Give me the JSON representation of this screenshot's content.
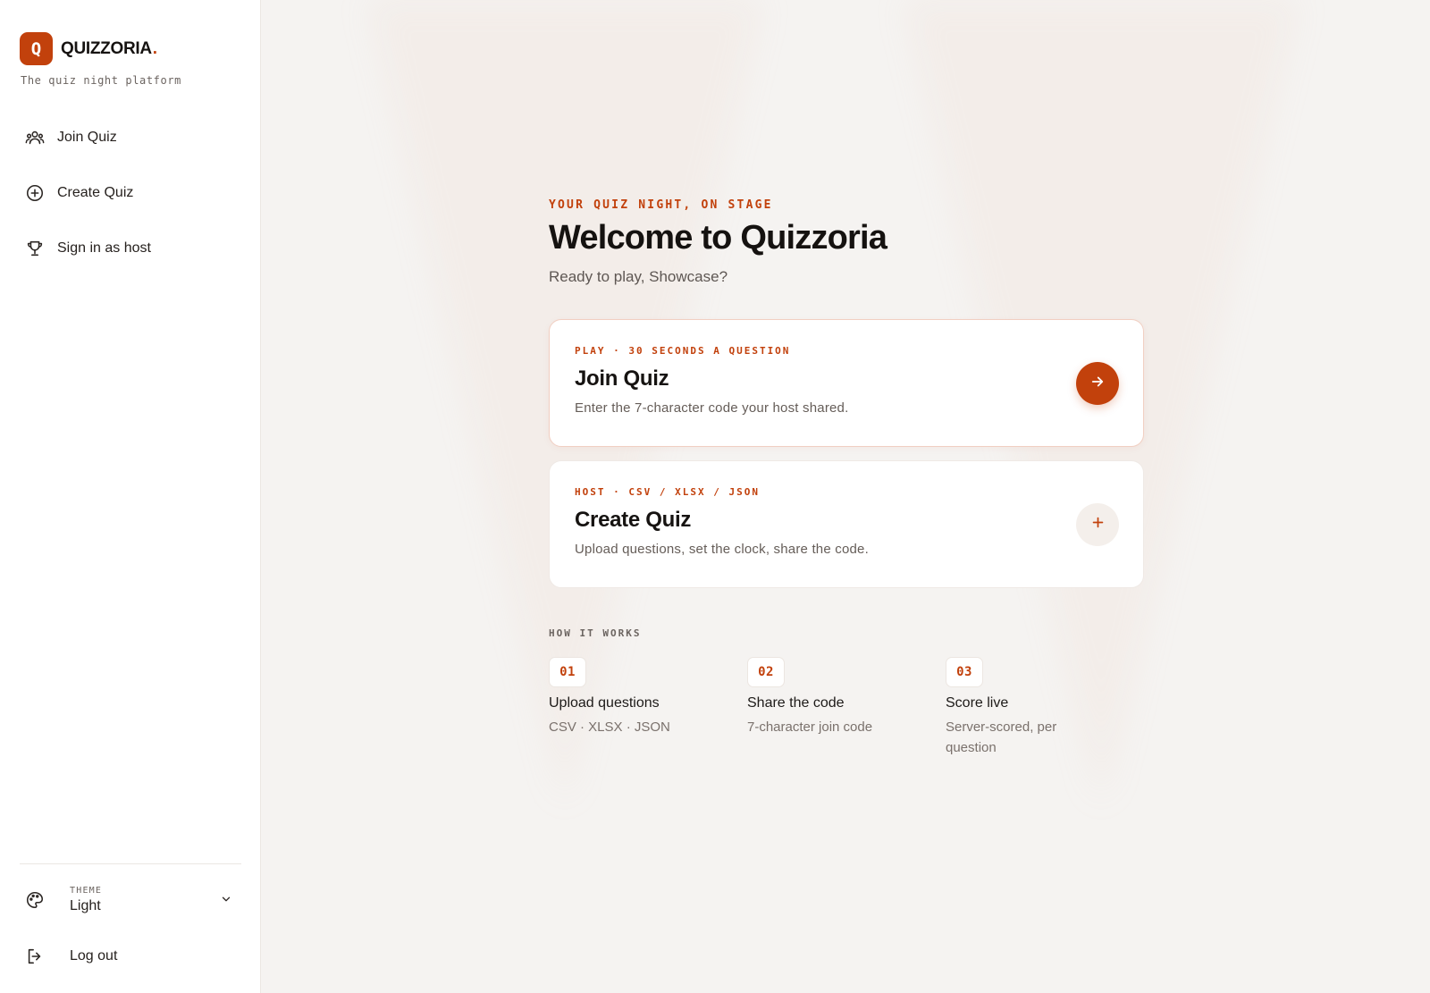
{
  "brand": {
    "logo_letter": "Q",
    "name": "QUIZZORIA",
    "dot": ".",
    "tagline": "The quiz night platform"
  },
  "sidebar": {
    "items": [
      {
        "label": "Join Quiz",
        "icon": "users-icon"
      },
      {
        "label": "Create Quiz",
        "icon": "plus-circle-icon"
      },
      {
        "label": "Sign in as host",
        "icon": "trophy-icon"
      }
    ],
    "theme": {
      "caption": "THEME",
      "value": "Light",
      "icon": "palette-icon"
    },
    "logout": {
      "label": "Log out",
      "icon": "logout-icon"
    }
  },
  "hero": {
    "eyebrow": "YOUR QUIZ NIGHT, ON STAGE",
    "title": "Welcome to Quizzoria",
    "subtitle": "Ready to play, Showcase?"
  },
  "cards": [
    {
      "kicker": "PLAY · 30 SECONDS A QUESTION",
      "title": "Join Quiz",
      "description": "Enter the 7-character code your host shared.",
      "action_icon": "arrow-right-icon"
    },
    {
      "kicker": "HOST · CSV / XLSX / JSON",
      "title": "Create Quiz",
      "description": "Upload questions, set the clock, share the code.",
      "action_icon": "plus-icon"
    }
  ],
  "how_it_works": {
    "title": "HOW IT WORKS",
    "steps": [
      {
        "number": "01",
        "title": "Upload questions",
        "description": "CSV · XLSX · JSON"
      },
      {
        "number": "02",
        "title": "Share the code",
        "description": "7-character join code"
      },
      {
        "number": "03",
        "title": "Score live",
        "description": "Server-scored, per question"
      }
    ]
  },
  "colors": {
    "accent": "#c2410c",
    "sidebar_bg": "#ffffff",
    "main_bg": "#f5f3f1"
  }
}
